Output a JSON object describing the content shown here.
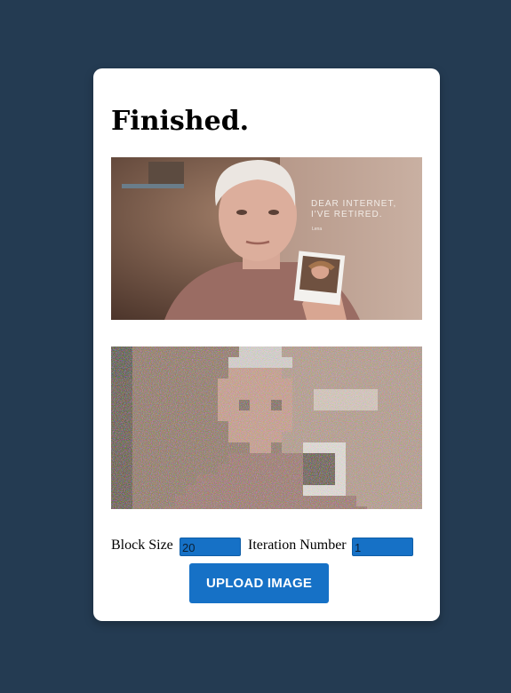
{
  "page": {
    "title": "Finished."
  },
  "images": {
    "original": {
      "headline_line1": "DEAR INTERNET,",
      "headline_line2": "I'VE RETIRED.",
      "signature": "Lena"
    }
  },
  "controls": {
    "block_size_label": "Block Size",
    "block_size_value": "20",
    "iteration_label": "Iteration Number",
    "iteration_value": "1"
  },
  "upload_button": {
    "label": "UPLOAD IMAGE"
  },
  "colors": {
    "background": "#243b52",
    "card": "#ffffff",
    "accent": "#1671c6"
  }
}
